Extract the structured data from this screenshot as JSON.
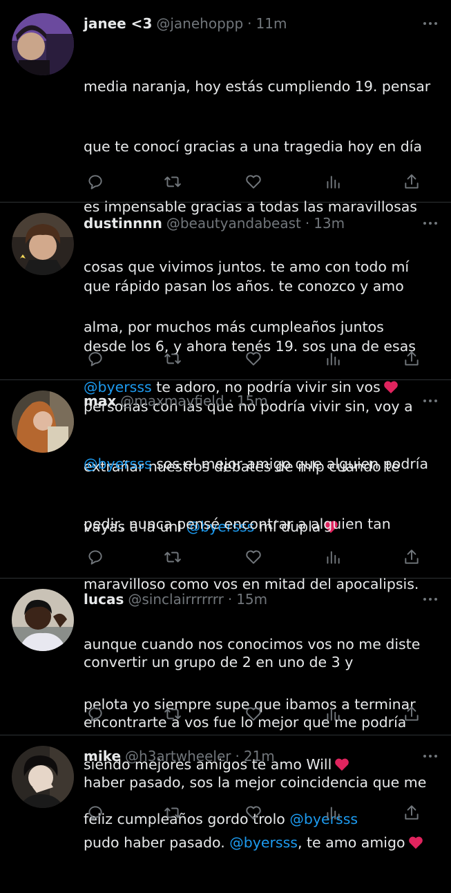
{
  "colors": {
    "background": "#000000",
    "text": "#e7e9ea",
    "secondary": "#71767b",
    "link": "#1d9bf0",
    "divider": "#2f3336",
    "heart": "#e0245e"
  },
  "tweets": [
    {
      "name": "janee <3",
      "handle": "@janehoppp",
      "separator": "·",
      "time": "11m",
      "text_lines": [
        "media naranja, hoy estás cumpliendo 19. pensar",
        "que te conocí gracias a una tragedia hoy en día",
        "es impensable gracias a todas las maravillosas",
        "cosas que vivimos juntos. te amo con todo mí",
        "alma, por muchos más cumpleaños juntos"
      ],
      "last_line": {
        "before": "",
        "mention": "@byersss",
        "after": " te adoro, no podría vivir sin vos"
      }
    },
    {
      "name": "dustinnnn",
      "handle": "@beautyandabeast",
      "separator": "·",
      "time": "13m",
      "text_lines": [
        "que rápido pasan los años. te conozco y amo",
        "desde los 6, y ahora tenés 19. sos una de esas",
        "personas con las que no podría vivir sin, voy a",
        "extrañar nuestros debates de mlp cuando te"
      ],
      "last_line": {
        "before": "vayas a la uni ",
        "mention": "@byersss",
        "after": " mí dupla"
      }
    },
    {
      "name": "max",
      "handle": "@maxmayfield",
      "separator": "·",
      "time": "15m",
      "first_line": {
        "mention": "@byersss",
        "after": " sos el mejor amigo que alguien podría"
      },
      "text_lines": [
        "pedir, nunca pensé encontrar a alguien tan",
        "maravilloso como vos en mitad del apocalipsis.",
        "aunque cuando nos conocimos vos no me diste",
        "pelota yo siempre supe que ibamos a terminar"
      ],
      "last_line": {
        "before": "siendo mejores amigos te amo Will",
        "mention": "",
        "after": ""
      }
    },
    {
      "name": "lucas",
      "handle": "@sinclairrrrrrr",
      "separator": "·",
      "time": "15m",
      "text_lines": [
        "convertir un grupo de 2 en uno de 3 y",
        "encontrarte a vos fue lo mejor que me podría",
        "haber pasado, sos la mejor coincidencia que me"
      ],
      "last_line": {
        "before": "pudo haber pasado. ",
        "mention": "@byersss",
        "after": ", te amo amigo"
      }
    },
    {
      "name": "mike",
      "handle": "@h3artwheeler",
      "separator": "·",
      "time": "21m",
      "text_lines": [],
      "last_line": {
        "before": "feliz cumpleaños gordo trolo ",
        "mention": "@byersss",
        "after": ""
      }
    }
  ],
  "icons": {
    "reply": "reply-icon",
    "retweet": "retweet-icon",
    "like": "like-icon",
    "views": "views-icon",
    "share": "share-icon",
    "more": "more-icon",
    "heart_emoji": "red-heart-emoji"
  }
}
